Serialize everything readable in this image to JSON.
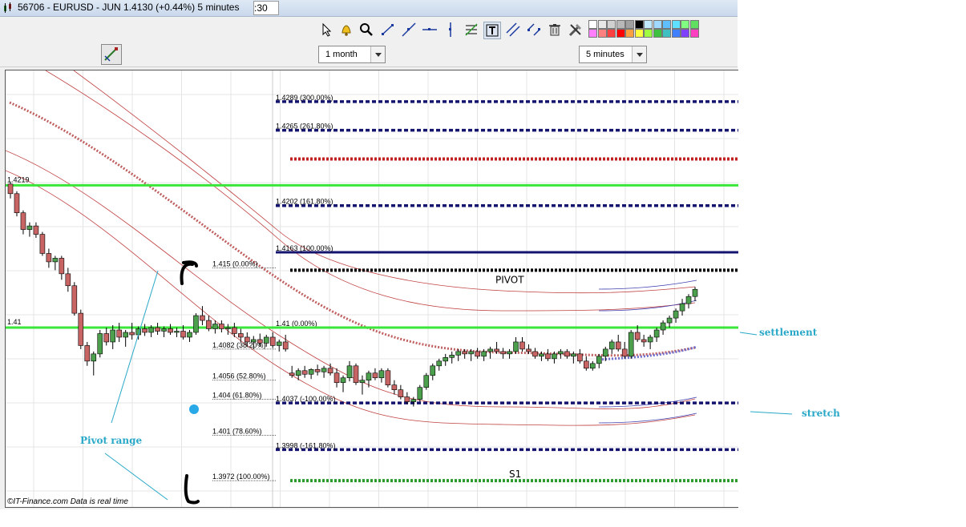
{
  "window": {
    "title": "56706 - EURUSD - JUN   1.4130 (+0.44%)   5 minutes",
    "time_field": ":30"
  },
  "toolbar": {
    "period_value": "1 month",
    "interval_value": "5 minutes",
    "palette_colors": [
      "#ffffff",
      "#e8e8e8",
      "#d0d0d0",
      "#b8b8b8",
      "#a0a0a0",
      "#000000",
      "#c0e8ff",
      "#a0d8ff",
      "#60c0ff",
      "#60e0ff",
      "#80ff80",
      "#60e060",
      "#ff80ff",
      "#ff8080",
      "#ff4040",
      "#ff0000",
      "#ffa040",
      "#ffff40",
      "#a0ff40",
      "#40c040",
      "#40c0c0",
      "#4080ff",
      "#8040ff",
      "#ff40c0"
    ]
  },
  "chart_data": {
    "type": "candlestick",
    "instrument": "EURUSD - JUN",
    "interval": "5 minutes",
    "ylim": [
      1.395,
      1.4315
    ],
    "grid": true,
    "watermark": "©IT-Finance.com  Data is real time",
    "candles": [
      [
        1.422,
        1.4222,
        1.4208,
        1.4212
      ],
      [
        1.4212,
        1.4214,
        1.4193,
        1.4196
      ],
      [
        1.4196,
        1.4198,
        1.4178,
        1.4182
      ],
      [
        1.4182,
        1.4188,
        1.4176,
        1.4185
      ],
      [
        1.4185,
        1.4188,
        1.4175,
        1.4178
      ],
      [
        1.4178,
        1.418,
        1.416,
        1.4162
      ],
      [
        1.4162,
        1.4166,
        1.415,
        1.4155
      ],
      [
        1.4155,
        1.416,
        1.4148,
        1.4158
      ],
      [
        1.4158,
        1.416,
        1.414,
        1.4145
      ],
      [
        1.4145,
        1.415,
        1.413,
        1.4135
      ],
      [
        1.4135,
        1.4138,
        1.411,
        1.4112
      ],
      [
        1.4112,
        1.4115,
        1.4082,
        1.4085
      ],
      [
        1.4085,
        1.4088,
        1.4068,
        1.4072
      ],
      [
        1.4072,
        1.408,
        1.406,
        1.4078
      ],
      [
        1.4078,
        1.4098,
        1.4075,
        1.4095
      ],
      [
        1.4095,
        1.41,
        1.4085,
        1.4088
      ],
      [
        1.4088,
        1.4102,
        1.4082,
        1.4098
      ],
      [
        1.4098,
        1.4104,
        1.4088,
        1.4092
      ],
      [
        1.4092,
        1.4098,
        1.4084,
        1.4096
      ],
      [
        1.4096,
        1.4104,
        1.409,
        1.4094
      ],
      [
        1.4094,
        1.4101,
        1.409,
        1.4099
      ],
      [
        1.4099,
        1.4103,
        1.4093,
        1.4096
      ],
      [
        1.4096,
        1.4102,
        1.4092,
        1.41
      ],
      [
        1.41,
        1.4104,
        1.4094,
        1.4097
      ],
      [
        1.4097,
        1.4101,
        1.4092,
        1.4099
      ],
      [
        1.4099,
        1.4103,
        1.4094,
        1.4096
      ],
      [
        1.4096,
        1.41,
        1.4092,
        1.4097
      ],
      [
        1.4097,
        1.4102,
        1.409,
        1.4092
      ],
      [
        1.4092,
        1.4098,
        1.4088,
        1.4096
      ],
      [
        1.4096,
        1.4112,
        1.4094,
        1.411
      ],
      [
        1.411,
        1.4118,
        1.4102,
        1.4106
      ],
      [
        1.4106,
        1.411,
        1.4097,
        1.4099
      ],
      [
        1.4099,
        1.4106,
        1.4095,
        1.4103
      ],
      [
        1.4103,
        1.4106,
        1.4096,
        1.4099
      ],
      [
        1.4099,
        1.4103,
        1.4094,
        1.41
      ],
      [
        1.41,
        1.4104,
        1.4092,
        1.4095
      ],
      [
        1.4095,
        1.4099,
        1.4088,
        1.4092
      ],
      [
        1.4092,
        1.4096,
        1.4084,
        1.4088
      ],
      [
        1.4088,
        1.4093,
        1.4082,
        1.409
      ],
      [
        1.409,
        1.4095,
        1.4084,
        1.4087
      ],
      [
        1.4087,
        1.4094,
        1.4084,
        1.4092
      ],
      [
        1.4092,
        1.4096,
        1.4083,
        1.4085
      ],
      [
        1.4085,
        1.409,
        1.408,
        1.4088
      ],
      [
        1.4088,
        1.4094,
        1.408,
        1.4082
      ],
      [
        1.4062,
        1.4068,
        1.4058,
        1.406
      ],
      [
        1.406,
        1.4066,
        1.4056,
        1.4064
      ],
      [
        1.4064,
        1.4068,
        1.4058,
        1.4061
      ],
      [
        1.4061,
        1.4066,
        1.4057,
        1.4065
      ],
      [
        1.4065,
        1.4069,
        1.406,
        1.4063
      ],
      [
        1.4063,
        1.4068,
        1.4058,
        1.4066
      ],
      [
        1.4066,
        1.407,
        1.406,
        1.4062
      ],
      [
        1.4062,
        1.4066,
        1.405,
        1.4054
      ],
      [
        1.4054,
        1.406,
        1.4046,
        1.4058
      ],
      [
        1.4058,
        1.4072,
        1.4055,
        1.4068
      ],
      [
        1.4068,
        1.407,
        1.4052,
        1.4054
      ],
      [
        1.4054,
        1.406,
        1.4044,
        1.4056
      ],
      [
        1.4056,
        1.4064,
        1.405,
        1.4062
      ],
      [
        1.4062,
        1.4066,
        1.4056,
        1.4058
      ],
      [
        1.4058,
        1.4066,
        1.4054,
        1.4064
      ],
      [
        1.4064,
        1.4066,
        1.405,
        1.4052
      ],
      [
        1.4052,
        1.4056,
        1.4044,
        1.4048
      ],
      [
        1.4048,
        1.4052,
        1.404,
        1.4042
      ],
      [
        1.4042,
        1.4046,
        1.4036,
        1.4038
      ],
      [
        1.4038,
        1.4042,
        1.4034,
        1.404
      ],
      [
        1.404,
        1.4052,
        1.4038,
        1.405
      ],
      [
        1.405,
        1.4062,
        1.4048,
        1.406
      ],
      [
        1.406,
        1.407,
        1.4056,
        1.4068
      ],
      [
        1.4068,
        1.4074,
        1.4064,
        1.4072
      ],
      [
        1.4072,
        1.4078,
        1.4068,
        1.4075
      ],
      [
        1.4075,
        1.408,
        1.407,
        1.4077
      ],
      [
        1.4077,
        1.4082,
        1.4072,
        1.408
      ],
      [
        1.408,
        1.4082,
        1.4074,
        1.4078
      ],
      [
        1.4078,
        1.4082,
        1.4072,
        1.408
      ],
      [
        1.408,
        1.4083,
        1.4074,
        1.4076
      ],
      [
        1.4076,
        1.4082,
        1.4072,
        1.408
      ],
      [
        1.408,
        1.4084,
        1.4074,
        1.4082
      ],
      [
        1.4082,
        1.4088,
        1.4078,
        1.408
      ],
      [
        1.408,
        1.4083,
        1.4074,
        1.4078
      ],
      [
        1.4078,
        1.4082,
        1.4074,
        1.408
      ],
      [
        1.408,
        1.4092,
        1.4078,
        1.4088
      ],
      [
        1.4088,
        1.4092,
        1.408,
        1.4082
      ],
      [
        1.4082,
        1.4086,
        1.4078,
        1.408
      ],
      [
        1.408,
        1.4083,
        1.4074,
        1.4076
      ],
      [
        1.4076,
        1.408,
        1.4072,
        1.4078
      ],
      [
        1.4078,
        1.4082,
        1.4072,
        1.4074
      ],
      [
        1.4074,
        1.408,
        1.407,
        1.4078
      ],
      [
        1.4078,
        1.4082,
        1.4074,
        1.408
      ],
      [
        1.408,
        1.4082,
        1.4074,
        1.4076
      ],
      [
        1.4076,
        1.408,
        1.407,
        1.4078
      ],
      [
        1.4078,
        1.4082,
        1.407,
        1.4072
      ],
      [
        1.4072,
        1.4076,
        1.4064,
        1.4066
      ],
      [
        1.4066,
        1.4072,
        1.4064,
        1.407
      ],
      [
        1.407,
        1.4078,
        1.4066,
        1.4076
      ],
      [
        1.4076,
        1.4084,
        1.4072,
        1.4082
      ],
      [
        1.4082,
        1.409,
        1.4078,
        1.4088
      ],
      [
        1.4088,
        1.4094,
        1.408,
        1.4082
      ],
      [
        1.4082,
        1.4088,
        1.4074,
        1.4076
      ],
      [
        1.4076,
        1.4098,
        1.4074,
        1.4096
      ],
      [
        1.4096,
        1.4102,
        1.4088,
        1.409
      ],
      [
        1.409,
        1.4094,
        1.4084,
        1.4088
      ],
      [
        1.4088,
        1.4094,
        1.4082,
        1.4092
      ],
      [
        1.4092,
        1.41,
        1.4088,
        1.4098
      ],
      [
        1.4098,
        1.4106,
        1.4094,
        1.4104
      ],
      [
        1.4104,
        1.411,
        1.41,
        1.4108
      ],
      [
        1.4108,
        1.4116,
        1.4104,
        1.4114
      ],
      [
        1.4114,
        1.4124,
        1.411,
        1.412
      ],
      [
        1.412,
        1.4128,
        1.4116,
        1.4126
      ],
      [
        1.4126,
        1.4134,
        1.4122,
        1.4132
      ]
    ],
    "fib_upper": [
      {
        "label": "1.4289 (300.00%)",
        "value": 1.4289,
        "color": "#14146e"
      },
      {
        "label": "1.4265 (261.80%)",
        "value": 1.4265,
        "color": "#14146e"
      },
      {
        "label": "1.4202 (161.80%)",
        "value": 1.4202,
        "color": "#14146e"
      },
      {
        "label": "1.4163 (100.00%)",
        "value": 1.4163,
        "color": "#14146e"
      },
      {
        "label": "1.41 (0.00%)",
        "value": 1.41,
        "color": "#14146e"
      },
      {
        "label": "1.4037 (-100.00%)",
        "value": 1.4037,
        "color": "#14146e"
      },
      {
        "label": "1.3998 (-161.80%)",
        "value": 1.3998,
        "color": "#14146e"
      }
    ],
    "fib_lower": [
      {
        "label": "1.415 (0.00%)",
        "value": 1.415
      },
      {
        "label": "1.4082 (38.20%)",
        "value": 1.4082
      },
      {
        "label": "1.4056 (52.80%)",
        "value": 1.4056
      },
      {
        "label": "1.404 (61.80%)",
        "value": 1.404
      },
      {
        "label": "1.401 (78.60%)",
        "value": 1.401
      },
      {
        "label": "1.3972 (100.00%)",
        "value": 1.3972
      }
    ],
    "horizontal_lines": [
      {
        "label": "1.4219",
        "value": 1.4219,
        "color": "#39e639"
      },
      {
        "label": "1.41",
        "value": 1.41,
        "color": "#39e639"
      }
    ],
    "pivot": {
      "label": "PIVOT",
      "value": 1.4148
    },
    "s1": {
      "label": "S1",
      "value": 1.3972
    },
    "red_dotted_level": 1.4241
  },
  "annotations": {
    "pivot_range": "Pivot range",
    "settlement": "settlement",
    "stretch": "stretch"
  }
}
